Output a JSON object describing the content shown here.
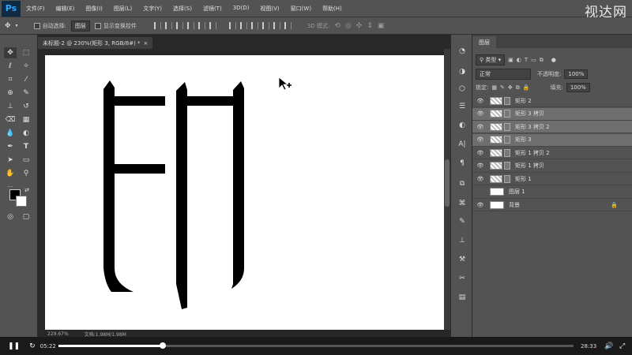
{
  "app": {
    "logo": "Ps"
  },
  "menu": [
    "文件(F)",
    "编辑(E)",
    "图像(I)",
    "图层(L)",
    "文字(Y)",
    "选择(S)",
    "滤镜(T)",
    "3D(D)",
    "视图(V)",
    "窗口(W)",
    "帮助(H)"
  ],
  "watermark": "视达网",
  "options": {
    "auto_select_label": "自动选择:",
    "auto_select_value": "图层",
    "transform_label": "显示变换控件",
    "mode3d_label": "3D 模式:"
  },
  "document": {
    "tab_label": "未标题-2 @ 230%(矩形 3, RGB/8#) *",
    "close": "×"
  },
  "status": {
    "zoom": "229.67%",
    "doc_size": "文档:1.98M/1.98M"
  },
  "panel": {
    "tab": "图层",
    "filter_kind": "类型",
    "blend_mode": "正常",
    "opacity_label": "不透明度:",
    "opacity_value": "100%",
    "lock_label": "锁定:",
    "fill_label": "填充:",
    "fill_value": "100%",
    "layers": [
      {
        "name": "矩形 2",
        "selected": false,
        "visible": true,
        "type": "shape"
      },
      {
        "name": "矩形 3 拷贝",
        "selected": true,
        "visible": true,
        "type": "shape"
      },
      {
        "name": "矩形 3 拷贝 2",
        "selected": true,
        "visible": true,
        "type": "shape"
      },
      {
        "name": "矩形 3",
        "selected": true,
        "visible": true,
        "type": "shape"
      },
      {
        "name": "矩形 1 拷贝 2",
        "selected": false,
        "visible": true,
        "type": "shape"
      },
      {
        "name": "矩形 1 拷贝",
        "selected": false,
        "visible": true,
        "type": "shape"
      },
      {
        "name": "矩形 1",
        "selected": false,
        "visible": true,
        "type": "shape"
      },
      {
        "name": "图层 1",
        "selected": false,
        "visible": false,
        "type": "pixel"
      },
      {
        "name": "背景",
        "selected": false,
        "visible": true,
        "type": "background",
        "locked": true
      }
    ]
  },
  "player": {
    "current_time": "05:22",
    "total_time": "28:33",
    "progress": 0.203
  },
  "colors": {
    "foreground": "#000000",
    "background": "#ffffff",
    "accent": "#31a8ff"
  }
}
